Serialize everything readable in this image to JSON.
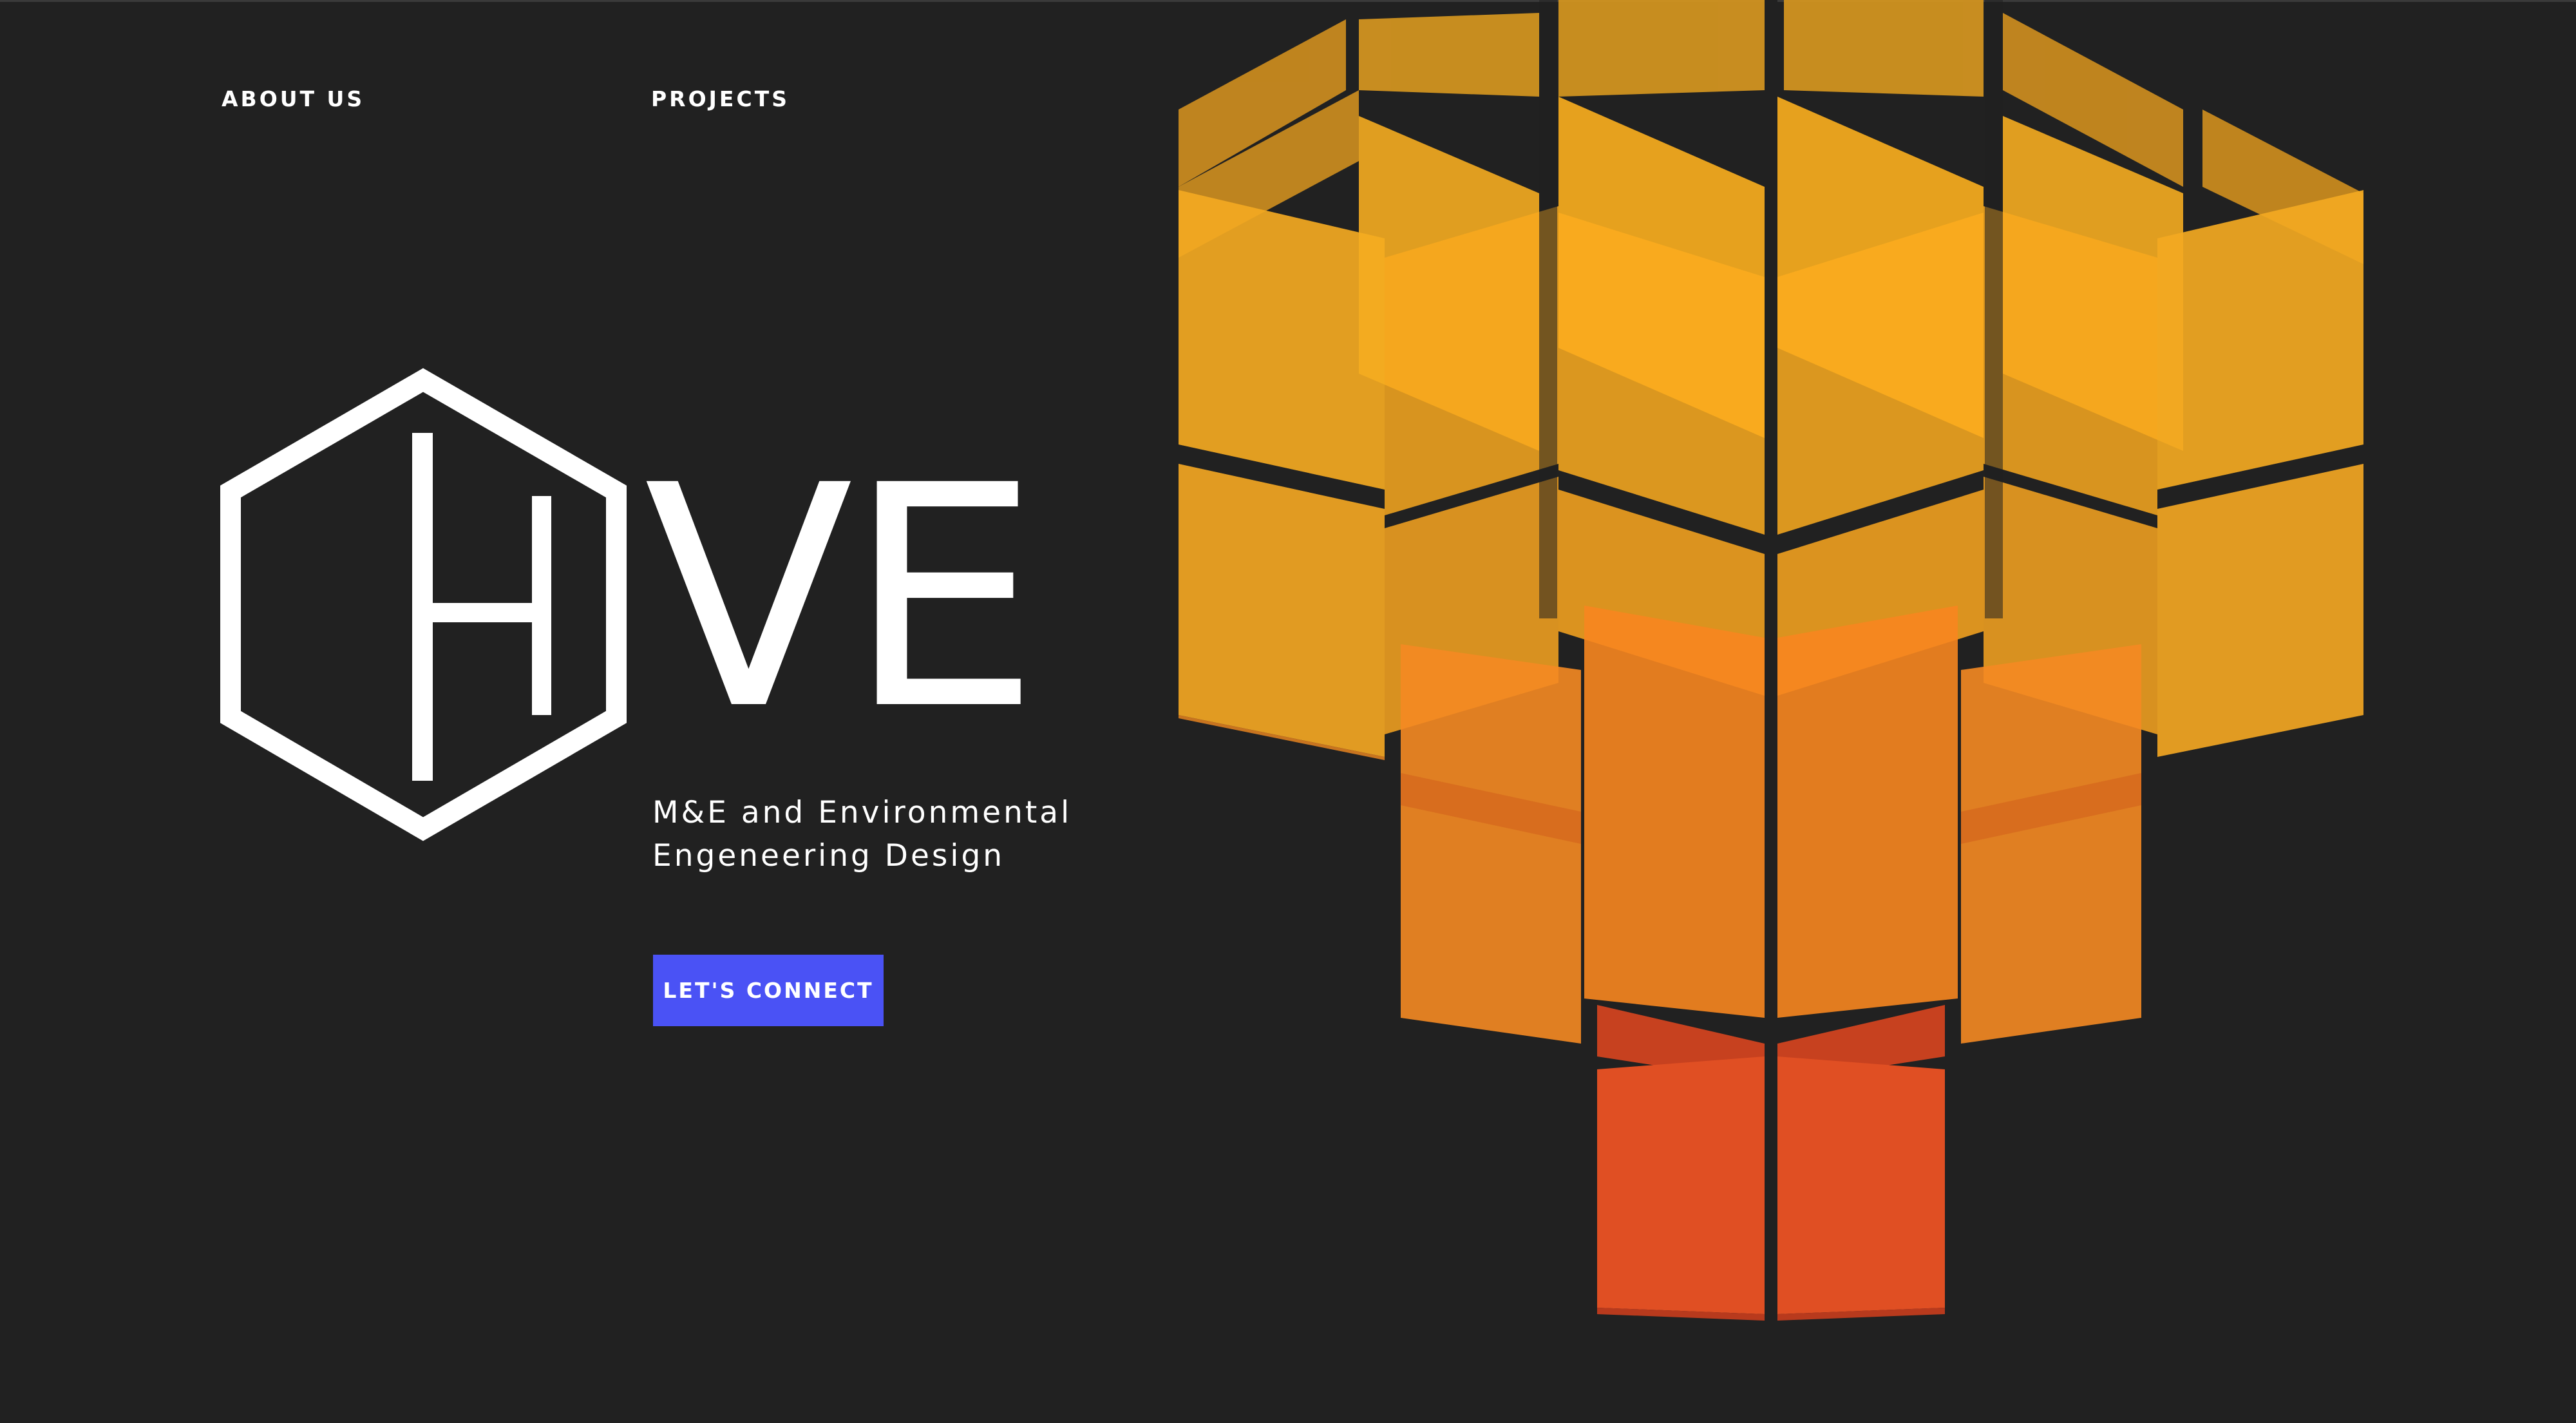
{
  "nav": {
    "about_label": "ABOUT US",
    "projects_label": "PROJECTS"
  },
  "brand": {
    "logo_mark_letter": "H",
    "logo_text": "VE",
    "tagline_line1": "M&E and Environmental",
    "tagline_line2": "Engeneering Design"
  },
  "cta": {
    "label": "LET'S CONNECT"
  },
  "colors": {
    "background": "#212121",
    "text": "#ffffff",
    "button": "#4a52f5",
    "cube_top": "#f7a91e",
    "cube_mid": "#f6871f",
    "cube_bottom": "#e0512a"
  },
  "icons": {
    "logo": "hexagon-h-logo",
    "hero_art": "isometric-cube-stack"
  }
}
